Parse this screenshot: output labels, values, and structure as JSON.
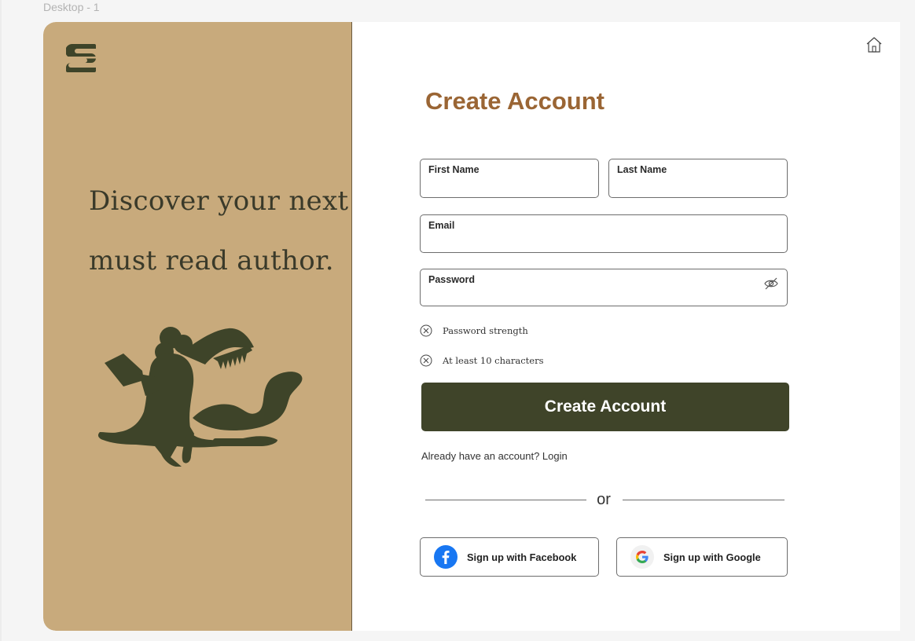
{
  "canvas": {
    "frame_label": "Desktop - 1"
  },
  "brand": {
    "logo_icon": "stacked-s-logo-icon",
    "tagline_line1": "Discover your next",
    "tagline_line2": "must read author.",
    "illustration": "person-reading-book-illustration",
    "panel_color": "#c8aa7c",
    "ink_color": "#3e4429"
  },
  "header": {
    "home_icon": "home-icon"
  },
  "form": {
    "title": "Create Account",
    "title_color": "#9a6534",
    "first_name": {
      "label": "First Name",
      "value": ""
    },
    "last_name": {
      "label": "Last Name",
      "value": ""
    },
    "email": {
      "label": "Email",
      "value": ""
    },
    "password": {
      "label": "Password",
      "value": "",
      "toggle_icon": "eye-off-icon"
    },
    "rules": [
      {
        "icon": "x-circle-icon",
        "text": "Password strength"
      },
      {
        "icon": "x-circle-icon",
        "text": "At least 10 characters"
      }
    ],
    "submit_label": "Create Account",
    "submit_color": "#3f4429",
    "login_prompt": "Already have an account? Login",
    "divider_text": "or"
  },
  "social": {
    "facebook": {
      "label": "Sign up with Facebook",
      "icon": "facebook-icon",
      "color": "#1877f2"
    },
    "google": {
      "label": "Sign up with Google",
      "icon": "google-icon"
    }
  }
}
